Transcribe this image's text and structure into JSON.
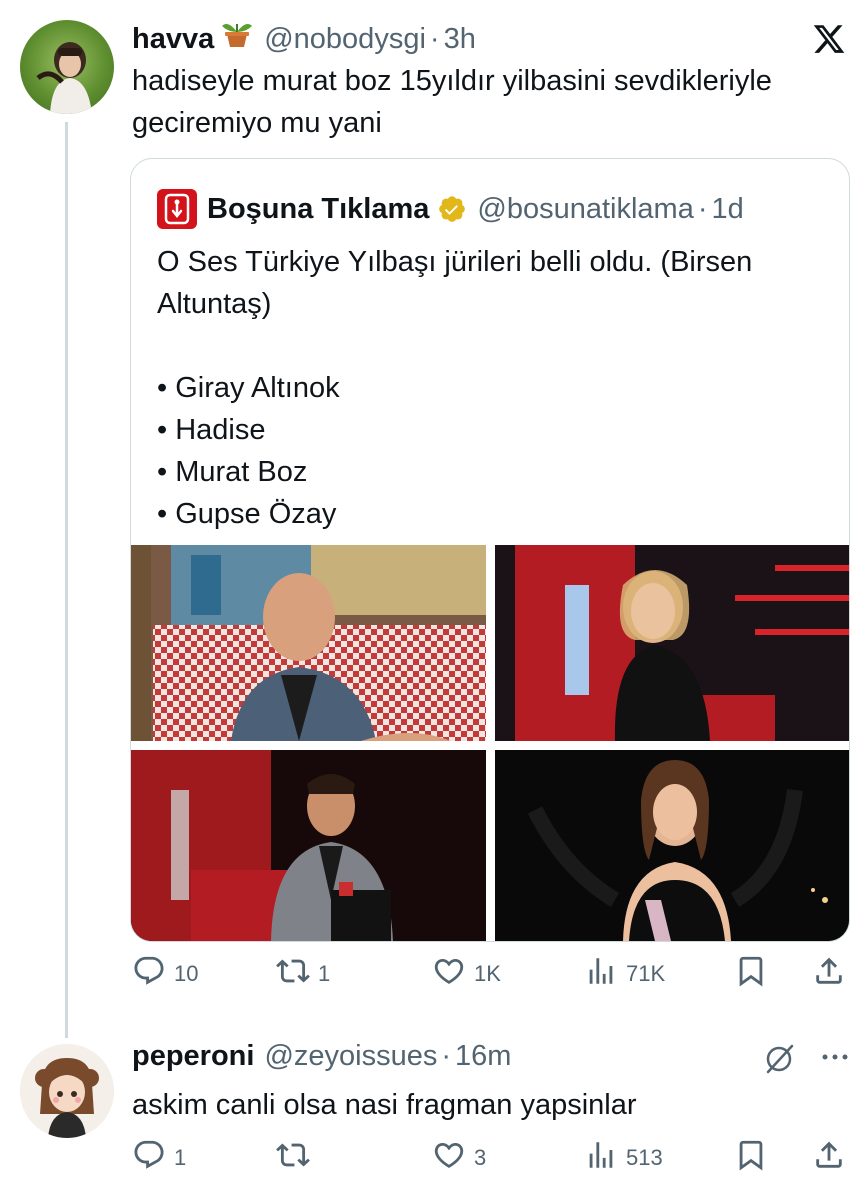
{
  "colors": {
    "text": "#0f1419",
    "muted": "#536471",
    "border": "#cfd9de",
    "brand_red": "#d4121a",
    "verified_gold": "#e2b719"
  },
  "tweet1": {
    "name": "havva",
    "emoji": "potted-plant-icon",
    "handle": "@nobodysgi",
    "dot": "·",
    "time": "3h",
    "text": "hadiseyle murat boz 15yıldır yilbasini sevdikleriyle geciremiyo mu yani",
    "quote": {
      "name": "Boşuna Tıklama",
      "handle": "@bosunatiklama",
      "dot": "·",
      "time": "1d",
      "line1": "O Ses Türkiye Yılbaşı jürileri belli oldu. (Birsen Altuntaş)",
      "bullets": [
        "• Giray Altınok",
        "• Hadise",
        "• Murat Boz",
        "• Gupse Özay"
      ]
    },
    "stats": {
      "replies": "10",
      "retweets": "1",
      "likes": "1K",
      "views": "71K"
    }
  },
  "tweet2": {
    "name": "peperoni",
    "handle": "@zeyoissues",
    "dot": "·",
    "time": "16m",
    "text": "askim canli olsa nasi fragman yapsinlar",
    "stats": {
      "replies": "1",
      "retweets": "",
      "likes": "3",
      "views": "513"
    }
  }
}
